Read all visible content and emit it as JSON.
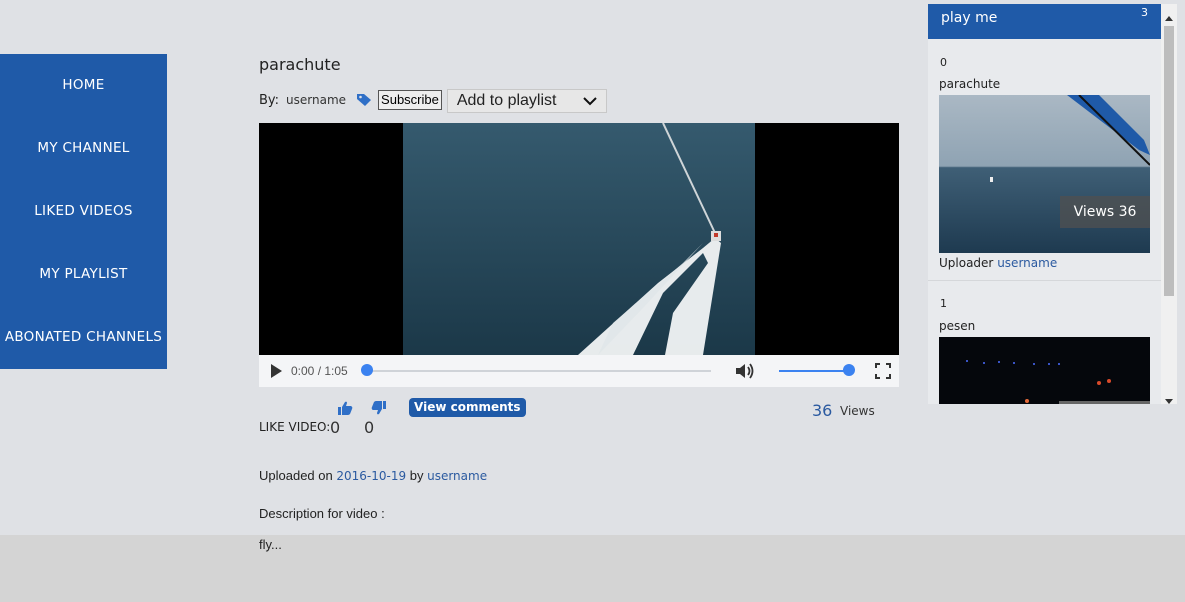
{
  "nav": {
    "items": [
      {
        "label": "HOME"
      },
      {
        "label": "MY CHANNEL"
      },
      {
        "label": "LIKED VIDEOS"
      },
      {
        "label": "MY PLAYLIST"
      },
      {
        "label": "ABONATED CHANNELS"
      }
    ]
  },
  "video": {
    "title": "parachute",
    "by_label": "By:",
    "author": "username",
    "subscribe_label": "Subscribe",
    "playlist_select": "Add to playlist",
    "time": "0:00 / 1:05",
    "progress": 0,
    "volume": 1.0,
    "like_label": "LIKE VIDEO:",
    "likes": "0",
    "dislikes": "0",
    "view_comments_label": "View comments",
    "views_count": "36",
    "views_label": "Views",
    "uploaded_prefix": "Uploaded on",
    "uploaded_date": "2016-10-19",
    "uploaded_by": "by",
    "uploader": "username",
    "description_label": "Description for video :",
    "description": "fly..."
  },
  "playlist_panel": {
    "title": "play me",
    "count": "3",
    "items": [
      {
        "index": "0",
        "title": "parachute",
        "views_badge": "Views 36",
        "uploader_label": "Uploader",
        "uploader": "username"
      },
      {
        "index": "1",
        "title": "pesen"
      }
    ]
  },
  "colors": {
    "accent": "#1f5aa8",
    "link": "#2b5aa0",
    "background": "#dfe1e5",
    "player_blue": "#3b82f0"
  }
}
